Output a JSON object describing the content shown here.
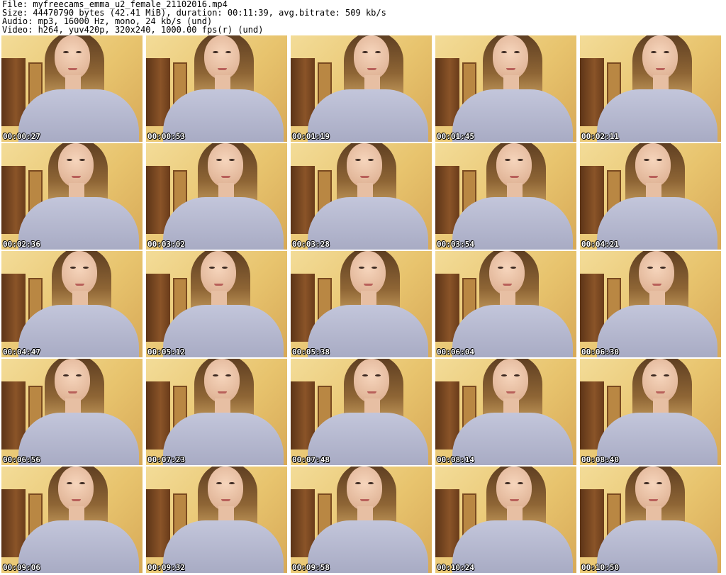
{
  "header": {
    "line1": "File: myfreecams_emma_u2_female_21102016.mp4",
    "line2": "Size: 44470790 bytes (42.41 MiB), duration: 00:11:39, avg.bitrate: 509 kb/s",
    "line3": "Audio: mp3, 16000 Hz, mono, 24 kb/s (und)",
    "line4": "Video: h264, yuv420p, 320x240, 1000.00 fps(r) (und)"
  },
  "thumbnails": [
    {
      "timestamp": "00:00:27"
    },
    {
      "timestamp": "00:00:53"
    },
    {
      "timestamp": "00:01:19"
    },
    {
      "timestamp": "00:01:45"
    },
    {
      "timestamp": "00:02:11"
    },
    {
      "timestamp": "00:02:36"
    },
    {
      "timestamp": "00:03:02"
    },
    {
      "timestamp": "00:03:28"
    },
    {
      "timestamp": "00:03:54"
    },
    {
      "timestamp": "00:04:21"
    },
    {
      "timestamp": "00:04:47"
    },
    {
      "timestamp": "00:05:12"
    },
    {
      "timestamp": "00:05:38"
    },
    {
      "timestamp": "00:06:04"
    },
    {
      "timestamp": "00:06:30"
    },
    {
      "timestamp": "00:06:56"
    },
    {
      "timestamp": "00:07:23"
    },
    {
      "timestamp": "00:07:48"
    },
    {
      "timestamp": "00:08:14"
    },
    {
      "timestamp": "00:08:40"
    },
    {
      "timestamp": "00:09:06"
    },
    {
      "timestamp": "00:09:32"
    },
    {
      "timestamp": "00:09:58"
    },
    {
      "timestamp": "00:10:24"
    },
    {
      "timestamp": "00:10:50"
    }
  ]
}
